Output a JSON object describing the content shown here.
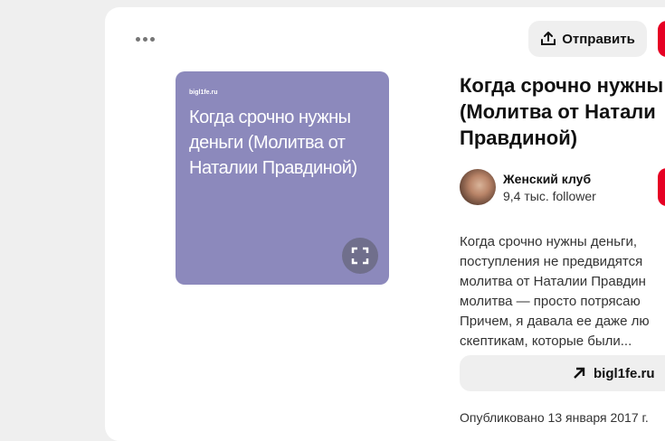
{
  "toolbar": {
    "more_icon": "more-horizontal-icon",
    "send_label": "Отправить",
    "send_icon": "upload-icon"
  },
  "pin": {
    "image_site": "bigl1fe.ru",
    "image_text": "Когда срочно нужны деньги (Молитва от Наталии Правдиной)",
    "image_bg": "#8c89bc",
    "zoom_icon": "expand-icon",
    "title_lines": [
      "Когда срочно нужны",
      "(Молитва от Натали",
      "Правдиной)"
    ]
  },
  "author": {
    "name": "Женский клуб",
    "followers": "9,4 тыс. follower"
  },
  "description_lines": [
    "Когда срочно нужны деньги,",
    "поступления не предвидятся",
    "молитва от Наталии Правдин",
    "молитва — просто потрясаю",
    "Причем, я давала ее даже лю",
    "скептикам, которые были..."
  ],
  "link": {
    "label": "bigl1fe.ru",
    "icon": "arrow-up-right-icon"
  },
  "published": "Опубликовано 13 января 2017 г.",
  "colors": {
    "accent_red": "#e60023",
    "button_gray": "#efefef"
  }
}
